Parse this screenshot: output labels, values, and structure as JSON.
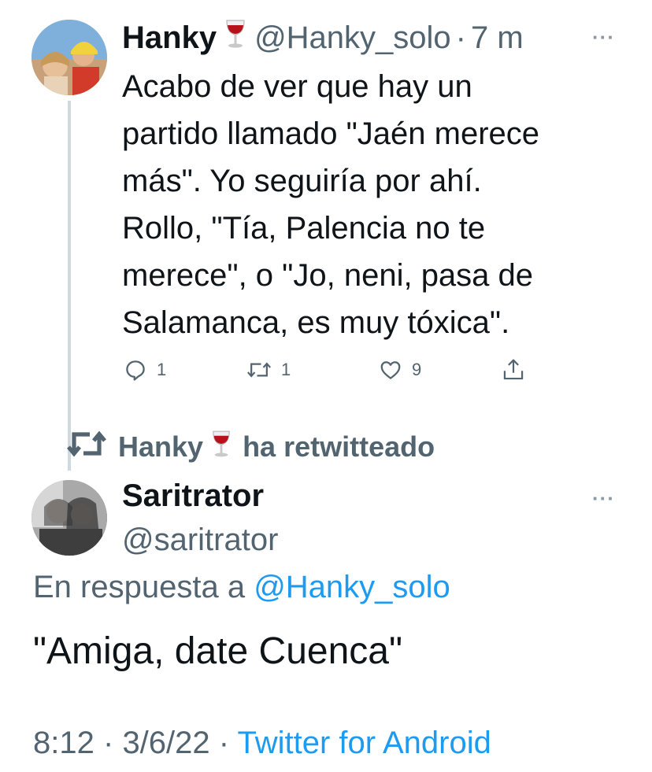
{
  "reply_tweet": {
    "author_name": "Hanky",
    "author_emoji": "wine-glass-icon",
    "handle": "@Hanky_solo",
    "separator": "·",
    "time_ago": "7 m",
    "more": "···",
    "text_lines": [
      "Acabo de ver que hay un",
      "partido llamado \"Jaén merece",
      "más\". Yo seguiría por ahí.",
      "Rollo, \"Tía, Palencia no te",
      "merece\", o \"Jo, neni, pasa de",
      "Salamanca, es muy tóxica\"."
    ],
    "actions": {
      "reply_count": "1",
      "retweet_count": "1",
      "like_count": "9"
    }
  },
  "retweet_banner": {
    "user": "Hanky",
    "label": "ha retwitteado"
  },
  "main_tweet": {
    "author_name": "Saritrator",
    "handle": "@saritrator",
    "more": "···",
    "reply_prefix": "En respuesta a",
    "reply_mention": "@Hanky_solo",
    "text": "\"Amiga, date Cuenca\"",
    "time": "8:12",
    "date": "3/6/22",
    "dot": "·",
    "source": "Twitter for Android"
  },
  "colors": {
    "text": "#0f1419",
    "secondary": "#536471",
    "link": "#1d9bf0",
    "thread_line": "#cfd9de"
  }
}
